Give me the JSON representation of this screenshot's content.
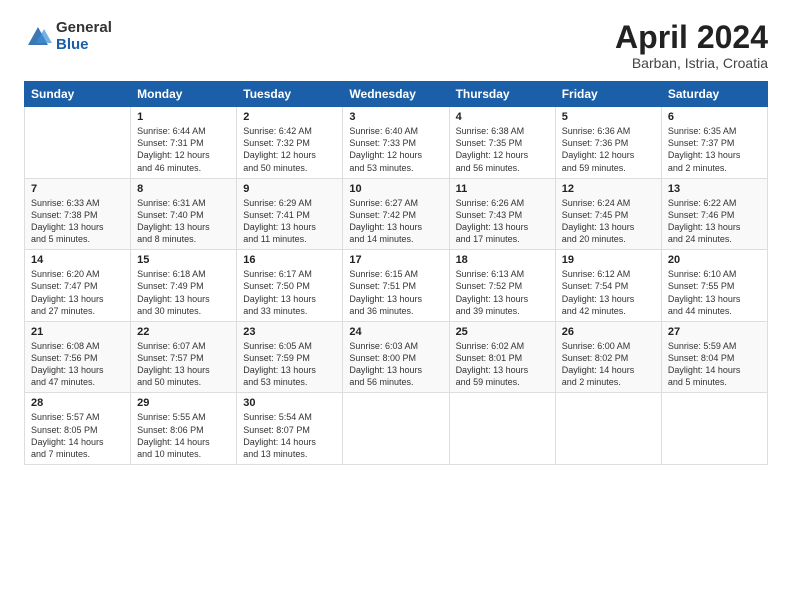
{
  "header": {
    "logo_general": "General",
    "logo_blue": "Blue",
    "month_title": "April 2024",
    "location": "Barban, Istria, Croatia"
  },
  "days_of_week": [
    "Sunday",
    "Monday",
    "Tuesday",
    "Wednesday",
    "Thursday",
    "Friday",
    "Saturday"
  ],
  "weeks": [
    [
      {
        "num": "",
        "info": ""
      },
      {
        "num": "1",
        "info": "Sunrise: 6:44 AM\nSunset: 7:31 PM\nDaylight: 12 hours\nand 46 minutes."
      },
      {
        "num": "2",
        "info": "Sunrise: 6:42 AM\nSunset: 7:32 PM\nDaylight: 12 hours\nand 50 minutes."
      },
      {
        "num": "3",
        "info": "Sunrise: 6:40 AM\nSunset: 7:33 PM\nDaylight: 12 hours\nand 53 minutes."
      },
      {
        "num": "4",
        "info": "Sunrise: 6:38 AM\nSunset: 7:35 PM\nDaylight: 12 hours\nand 56 minutes."
      },
      {
        "num": "5",
        "info": "Sunrise: 6:36 AM\nSunset: 7:36 PM\nDaylight: 12 hours\nand 59 minutes."
      },
      {
        "num": "6",
        "info": "Sunrise: 6:35 AM\nSunset: 7:37 PM\nDaylight: 13 hours\nand 2 minutes."
      }
    ],
    [
      {
        "num": "7",
        "info": "Sunrise: 6:33 AM\nSunset: 7:38 PM\nDaylight: 13 hours\nand 5 minutes."
      },
      {
        "num": "8",
        "info": "Sunrise: 6:31 AM\nSunset: 7:40 PM\nDaylight: 13 hours\nand 8 minutes."
      },
      {
        "num": "9",
        "info": "Sunrise: 6:29 AM\nSunset: 7:41 PM\nDaylight: 13 hours\nand 11 minutes."
      },
      {
        "num": "10",
        "info": "Sunrise: 6:27 AM\nSunset: 7:42 PM\nDaylight: 13 hours\nand 14 minutes."
      },
      {
        "num": "11",
        "info": "Sunrise: 6:26 AM\nSunset: 7:43 PM\nDaylight: 13 hours\nand 17 minutes."
      },
      {
        "num": "12",
        "info": "Sunrise: 6:24 AM\nSunset: 7:45 PM\nDaylight: 13 hours\nand 20 minutes."
      },
      {
        "num": "13",
        "info": "Sunrise: 6:22 AM\nSunset: 7:46 PM\nDaylight: 13 hours\nand 24 minutes."
      }
    ],
    [
      {
        "num": "14",
        "info": "Sunrise: 6:20 AM\nSunset: 7:47 PM\nDaylight: 13 hours\nand 27 minutes."
      },
      {
        "num": "15",
        "info": "Sunrise: 6:18 AM\nSunset: 7:49 PM\nDaylight: 13 hours\nand 30 minutes."
      },
      {
        "num": "16",
        "info": "Sunrise: 6:17 AM\nSunset: 7:50 PM\nDaylight: 13 hours\nand 33 minutes."
      },
      {
        "num": "17",
        "info": "Sunrise: 6:15 AM\nSunset: 7:51 PM\nDaylight: 13 hours\nand 36 minutes."
      },
      {
        "num": "18",
        "info": "Sunrise: 6:13 AM\nSunset: 7:52 PM\nDaylight: 13 hours\nand 39 minutes."
      },
      {
        "num": "19",
        "info": "Sunrise: 6:12 AM\nSunset: 7:54 PM\nDaylight: 13 hours\nand 42 minutes."
      },
      {
        "num": "20",
        "info": "Sunrise: 6:10 AM\nSunset: 7:55 PM\nDaylight: 13 hours\nand 44 minutes."
      }
    ],
    [
      {
        "num": "21",
        "info": "Sunrise: 6:08 AM\nSunset: 7:56 PM\nDaylight: 13 hours\nand 47 minutes."
      },
      {
        "num": "22",
        "info": "Sunrise: 6:07 AM\nSunset: 7:57 PM\nDaylight: 13 hours\nand 50 minutes."
      },
      {
        "num": "23",
        "info": "Sunrise: 6:05 AM\nSunset: 7:59 PM\nDaylight: 13 hours\nand 53 minutes."
      },
      {
        "num": "24",
        "info": "Sunrise: 6:03 AM\nSunset: 8:00 PM\nDaylight: 13 hours\nand 56 minutes."
      },
      {
        "num": "25",
        "info": "Sunrise: 6:02 AM\nSunset: 8:01 PM\nDaylight: 13 hours\nand 59 minutes."
      },
      {
        "num": "26",
        "info": "Sunrise: 6:00 AM\nSunset: 8:02 PM\nDaylight: 14 hours\nand 2 minutes."
      },
      {
        "num": "27",
        "info": "Sunrise: 5:59 AM\nSunset: 8:04 PM\nDaylight: 14 hours\nand 5 minutes."
      }
    ],
    [
      {
        "num": "28",
        "info": "Sunrise: 5:57 AM\nSunset: 8:05 PM\nDaylight: 14 hours\nand 7 minutes."
      },
      {
        "num": "29",
        "info": "Sunrise: 5:55 AM\nSunset: 8:06 PM\nDaylight: 14 hours\nand 10 minutes."
      },
      {
        "num": "30",
        "info": "Sunrise: 5:54 AM\nSunset: 8:07 PM\nDaylight: 14 hours\nand 13 minutes."
      },
      {
        "num": "",
        "info": ""
      },
      {
        "num": "",
        "info": ""
      },
      {
        "num": "",
        "info": ""
      },
      {
        "num": "",
        "info": ""
      }
    ]
  ]
}
